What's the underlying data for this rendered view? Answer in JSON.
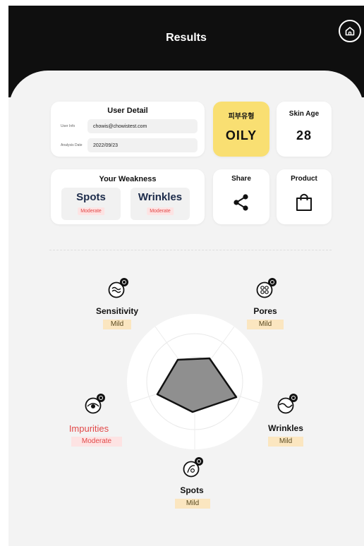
{
  "header": {
    "title": "Results"
  },
  "user_detail": {
    "title": "User Detail",
    "rows": [
      {
        "key": "User Info",
        "value": "chowis@chowistest.com"
      },
      {
        "key": "Analysis Date",
        "value": "2022/09/23"
      }
    ]
  },
  "skin_type": {
    "title": "피부유형",
    "value": "OILY"
  },
  "skin_age": {
    "title": "Skin Age",
    "value": "28"
  },
  "weakness": {
    "title": "Your Weakness",
    "items": [
      {
        "name": "Spots",
        "level": "Moderate"
      },
      {
        "name": "Wrinkles",
        "level": "Moderate"
      }
    ]
  },
  "share": {
    "label": "Share"
  },
  "product": {
    "label": "Product"
  },
  "metrics": [
    {
      "name": "Sensitivity",
      "level": "Mild",
      "icon": "sensitivity-icon"
    },
    {
      "name": "Pores",
      "level": "Mild",
      "icon": "pores-icon"
    },
    {
      "name": "Wrinkles",
      "level": "Mild",
      "icon": "wrinkles-icon"
    },
    {
      "name": "Spots",
      "level": "Mild",
      "icon": "spots-icon"
    },
    {
      "name": "Impurities",
      "level": "Moderate",
      "icon": "impurities-icon"
    }
  ],
  "colors": {
    "header_bg": "#0f0f0f",
    "skin_type_bg": "#f9df72",
    "weak_level_bg": "#fde3e3",
    "weak_level_text": "#e24848",
    "mild_bg": "#fbe6c0",
    "impurities_text": "#e24848"
  }
}
